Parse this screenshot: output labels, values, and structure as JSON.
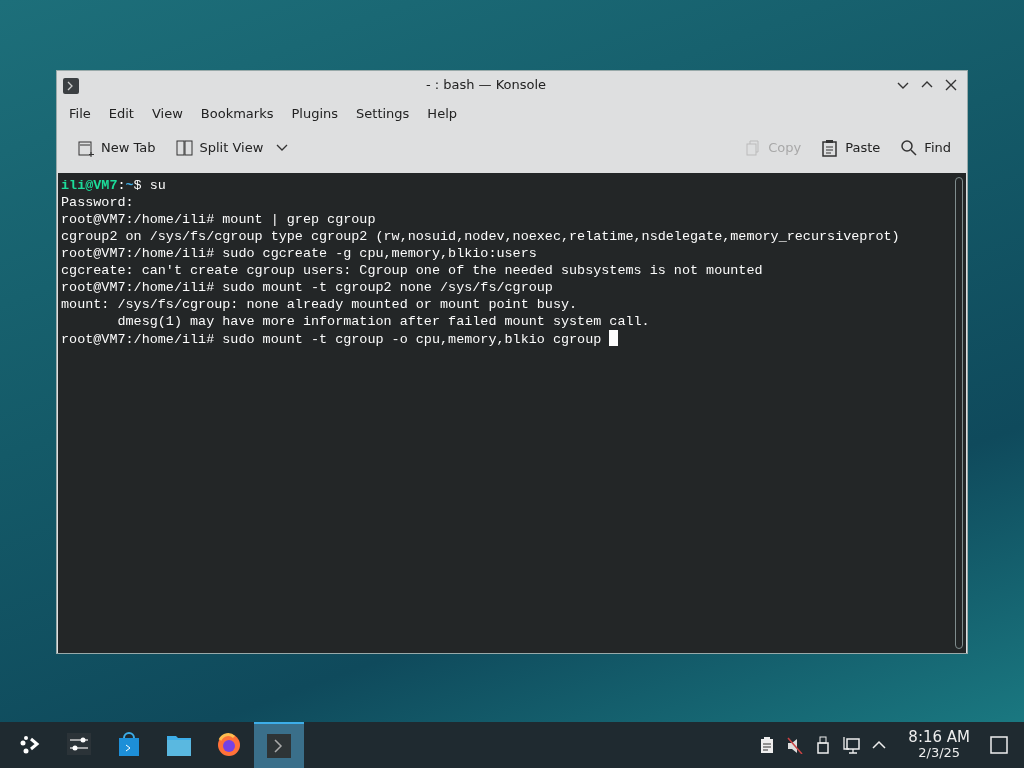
{
  "window": {
    "title": "- : bash — Konsole"
  },
  "menu": [
    "File",
    "Edit",
    "View",
    "Bookmarks",
    "Plugins",
    "Settings",
    "Help"
  ],
  "toolbar": {
    "left": [
      {
        "kind": "newtab",
        "label": "New Tab",
        "disabled": false
      },
      {
        "kind": "split",
        "label": "Split View",
        "disabled": false
      }
    ],
    "right": [
      {
        "kind": "copy",
        "label": "Copy",
        "disabled": true
      },
      {
        "kind": "paste",
        "label": "Paste",
        "disabled": false
      },
      {
        "kind": "find",
        "label": "Find",
        "disabled": false
      }
    ]
  },
  "terminal": {
    "lines": [
      {
        "kind": "user_prompt",
        "user": "ili@VM7",
        "sep": ":",
        "path": "~",
        "text": "$ su"
      },
      {
        "kind": "plain",
        "text": "Password:"
      },
      {
        "kind": "plain",
        "text": "root@VM7:/home/ili# mount | grep cgroup"
      },
      {
        "kind": "plain",
        "text": "cgroup2 on /sys/fs/cgroup type cgroup2 (rw,nosuid,nodev,noexec,relatime,nsdelegate,memory_recursiveprot)"
      },
      {
        "kind": "plain",
        "text": "root@VM7:/home/ili# sudo cgcreate -g cpu,memory,blkio:users"
      },
      {
        "kind": "plain",
        "text": "cgcreate: can't create cgroup users: Cgroup one of the needed subsystems is not mounted"
      },
      {
        "kind": "plain",
        "text": "root@VM7:/home/ili# sudo mount -t cgroup2 none /sys/fs/cgroup"
      },
      {
        "kind": "plain",
        "text": "mount: /sys/fs/cgroup: none already mounted or mount point busy."
      },
      {
        "kind": "plain",
        "text": "       dmesg(1) may have more information after failed mount system call."
      },
      {
        "kind": "plain",
        "text": "root@VM7:/home/ili# sudo mount -t cgroup -o cpu,memory,blkio cgroup "
      }
    ]
  },
  "taskbar": {
    "items": [
      {
        "kind": "launcher",
        "selected": false
      },
      {
        "kind": "settings",
        "selected": false
      },
      {
        "kind": "store",
        "selected": false
      },
      {
        "kind": "files",
        "selected": false
      },
      {
        "kind": "browser",
        "selected": false
      },
      {
        "kind": "terminal",
        "selected": true
      }
    ],
    "clock": {
      "time": "8:16 AM",
      "date": "2/3/25"
    }
  }
}
